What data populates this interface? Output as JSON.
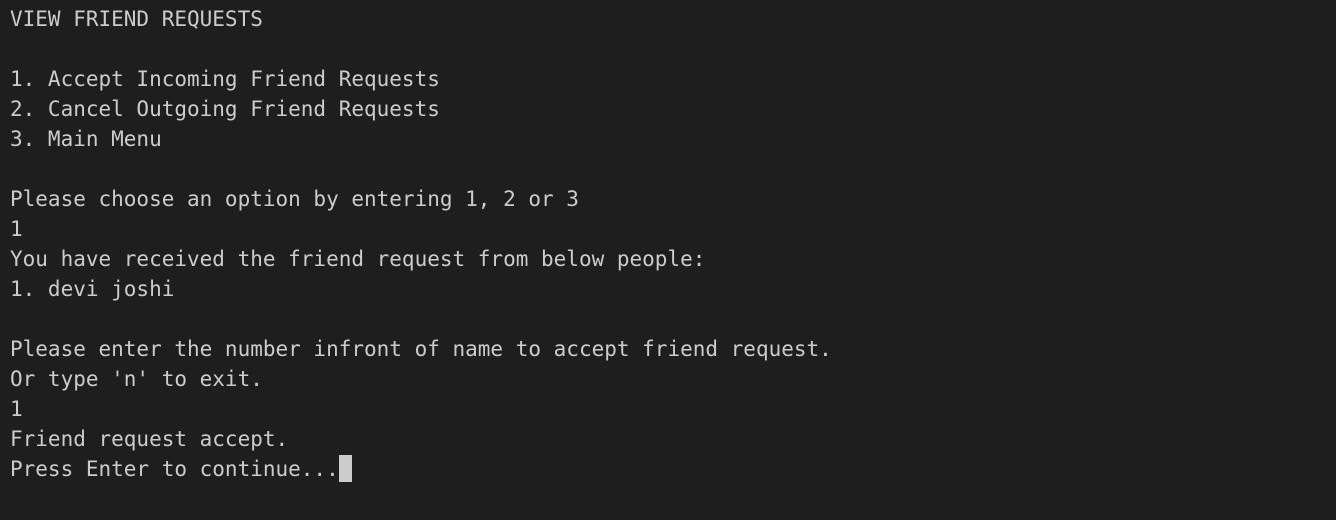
{
  "terminal": {
    "lines": [
      "VIEW FRIEND REQUESTS",
      "",
      "1. Accept Incoming Friend Requests",
      "2. Cancel Outgoing Friend Requests",
      "3. Main Menu",
      "",
      "Please choose an option by entering 1, 2 or 3",
      "1",
      "You have received the friend request from below people:",
      "1. devi joshi",
      "",
      "Please enter the number infront of name to accept friend request.",
      "Or type 'n' to exit.",
      "1",
      "Friend request accept.",
      "Press Enter to continue..."
    ],
    "colors": {
      "background": "#1e1e1e",
      "foreground": "#cccccc",
      "cursor": "#cccccc"
    }
  }
}
